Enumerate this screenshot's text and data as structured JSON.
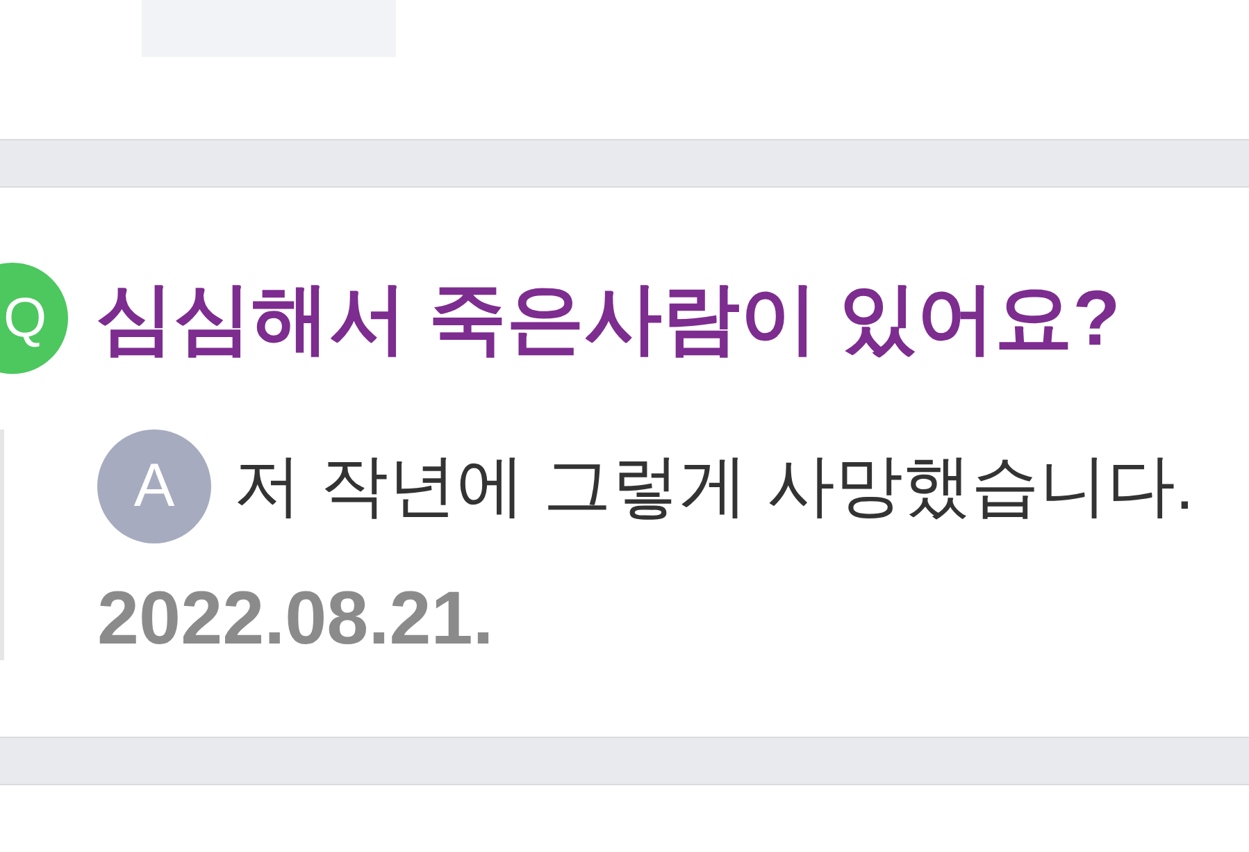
{
  "question": {
    "badge": "Q",
    "title": "심심해서 죽은사람이 있어요?"
  },
  "answer": {
    "badge": "A",
    "text": "저 작년에 그렇게 사망했습니다.",
    "date": "2022.08.21."
  }
}
